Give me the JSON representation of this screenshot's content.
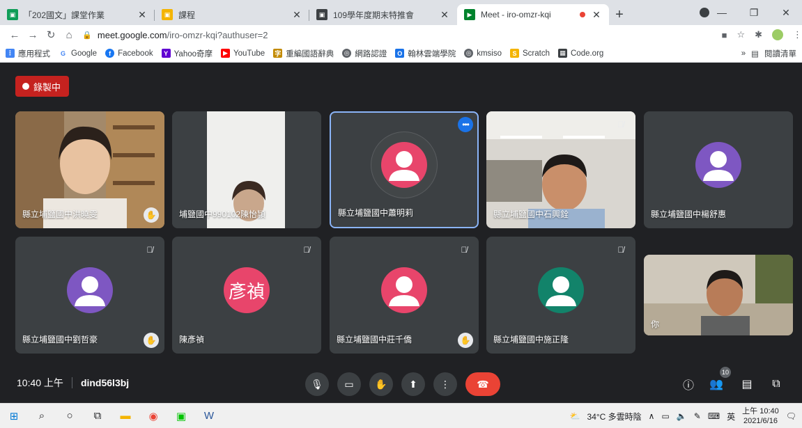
{
  "browser": {
    "tabs": [
      {
        "title": "「202國文」課堂作業",
        "favicon_color": "#0f9d58"
      },
      {
        "title": "課程",
        "favicon_color": "#f4b400"
      },
      {
        "title": "109學年度期末特推會",
        "favicon_color": "#3c4043"
      },
      {
        "title": "Meet - iro-omzr-kqi",
        "favicon_color": "#00832d",
        "recording": true
      }
    ],
    "url_host": "meet.google.com",
    "url_path": "/iro-omzr-kqi?authuser=2"
  },
  "bookmarks": [
    {
      "label": "應用程式",
      "color": "#4285f4",
      "glyph": "⋮⋮⋮"
    },
    {
      "label": "Google",
      "color": "#4285f4",
      "glyph": "G"
    },
    {
      "label": "Facebook",
      "color": "#1877f2",
      "glyph": "f"
    },
    {
      "label": "Yahoo奇摩",
      "color": "#6001d2",
      "glyph": "Y"
    },
    {
      "label": "YouTube",
      "color": "#ff0000",
      "glyph": "▶"
    },
    {
      "label": "重編國語辭典",
      "color": "#c28a00",
      "glyph": "字"
    },
    {
      "label": "網路認證",
      "color": "#5f6368",
      "glyph": "◎"
    },
    {
      "label": "翰林雲端學院",
      "color": "#1a73e8",
      "glyph": "O"
    },
    {
      "label": "kmsiso",
      "color": "#5f6368",
      "glyph": "◎"
    },
    {
      "label": "Scratch",
      "color": "#f4b400",
      "glyph": "S"
    },
    {
      "label": "Code.org",
      "color": "#3c4043",
      "glyph": "▦"
    }
  ],
  "bookmarks_right": {
    "more": "»",
    "reading_list": "閱讀清單"
  },
  "meet": {
    "recording_label": "錄製中",
    "meeting_time": "10:40 上午",
    "meeting_code": "dind56l3bj",
    "participants_count": "10",
    "tiles": [
      {
        "name": "縣立埔鹽國中洪曉雯",
        "type": "video",
        "hand": true
      },
      {
        "name": "埔鹽國中990102陳怡頴",
        "type": "video"
      },
      {
        "name": "縣立埔鹽國中蕭明莉",
        "type": "avatar",
        "color": "#e8456b",
        "speaking": true
      },
      {
        "name": "縣立埔鹽國中石興銓",
        "type": "video",
        "muted": true
      },
      {
        "name": "縣立埔鹽國中楊舒惠",
        "type": "avatar",
        "color": "#7e57c2"
      },
      {
        "name": "縣立埔鹽國中劉哲豪",
        "type": "avatar",
        "color": "#7e57c2",
        "muted": true,
        "hand": true
      },
      {
        "name": "陳彥禎",
        "type": "text-avatar",
        "initials": "彥禎",
        "color": "#e8456b",
        "muted": true
      },
      {
        "name": "縣立埔鹽國中莊千僑",
        "type": "avatar",
        "color": "#e8456b",
        "muted": true,
        "hand": true
      },
      {
        "name": "縣立埔鹽國中施正隆",
        "type": "avatar",
        "color": "#12836a",
        "muted": true
      },
      {
        "name": "你",
        "type": "video"
      }
    ]
  },
  "taskbar": {
    "weather": "34°C 多雲時陰",
    "ime": "英",
    "time": "上午 10:40",
    "date": "2021/6/16"
  }
}
